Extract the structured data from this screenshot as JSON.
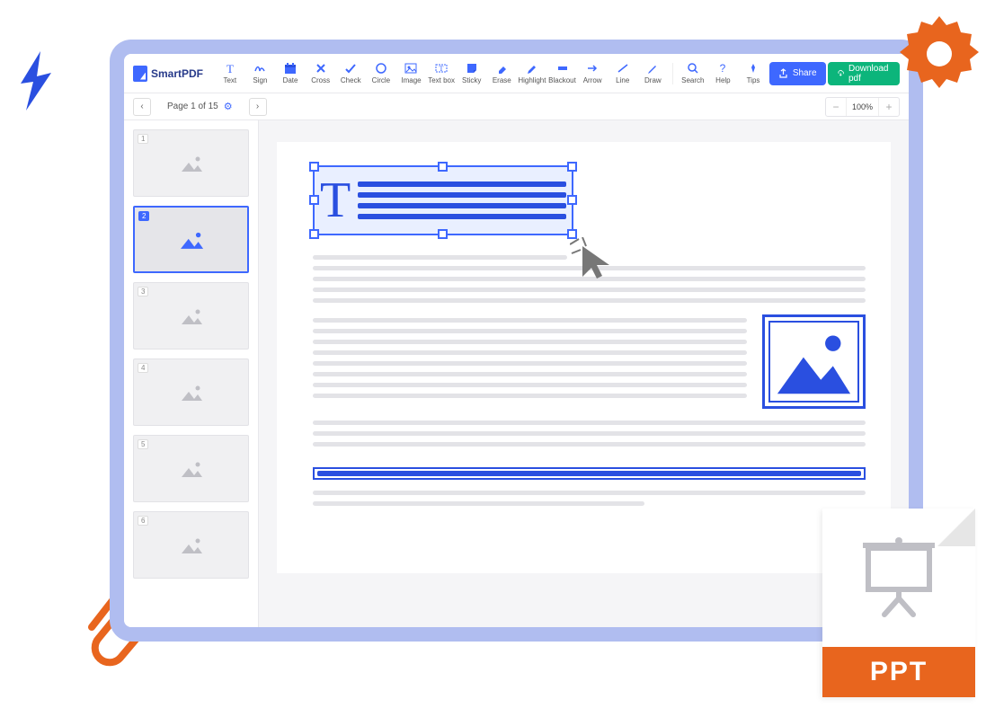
{
  "app": {
    "name": "SmartPDF"
  },
  "tools": [
    {
      "id": "text",
      "label": "Text"
    },
    {
      "id": "sign",
      "label": "Sign"
    },
    {
      "id": "date",
      "label": "Date"
    },
    {
      "id": "cross",
      "label": "Cross"
    },
    {
      "id": "check",
      "label": "Check"
    },
    {
      "id": "circle",
      "label": "Circle"
    },
    {
      "id": "image",
      "label": "Image"
    },
    {
      "id": "textbox",
      "label": "Text box"
    },
    {
      "id": "sticky",
      "label": "Sticky"
    },
    {
      "id": "erase",
      "label": "Erase"
    },
    {
      "id": "highlight",
      "label": "Highlight"
    },
    {
      "id": "blackout",
      "label": "Blackout"
    },
    {
      "id": "arrow",
      "label": "Arrow"
    },
    {
      "id": "line",
      "label": "Line"
    },
    {
      "id": "draw",
      "label": "Draw"
    }
  ],
  "tools_right": [
    {
      "id": "search",
      "label": "Search"
    },
    {
      "id": "help",
      "label": "Help"
    },
    {
      "id": "tips",
      "label": "Tips"
    }
  ],
  "buttons": {
    "share": "Share",
    "download": "Download pdf"
  },
  "pager": {
    "label": "Page 1 of 15"
  },
  "zoom": {
    "value": "100%"
  },
  "thumbs": [
    {
      "n": "1",
      "active": false
    },
    {
      "n": "2",
      "active": true
    },
    {
      "n": "3",
      "active": false
    },
    {
      "n": "4",
      "active": false
    },
    {
      "n": "5",
      "active": false
    },
    {
      "n": "6",
      "active": false
    }
  ],
  "ppt": {
    "label": "PPT"
  }
}
